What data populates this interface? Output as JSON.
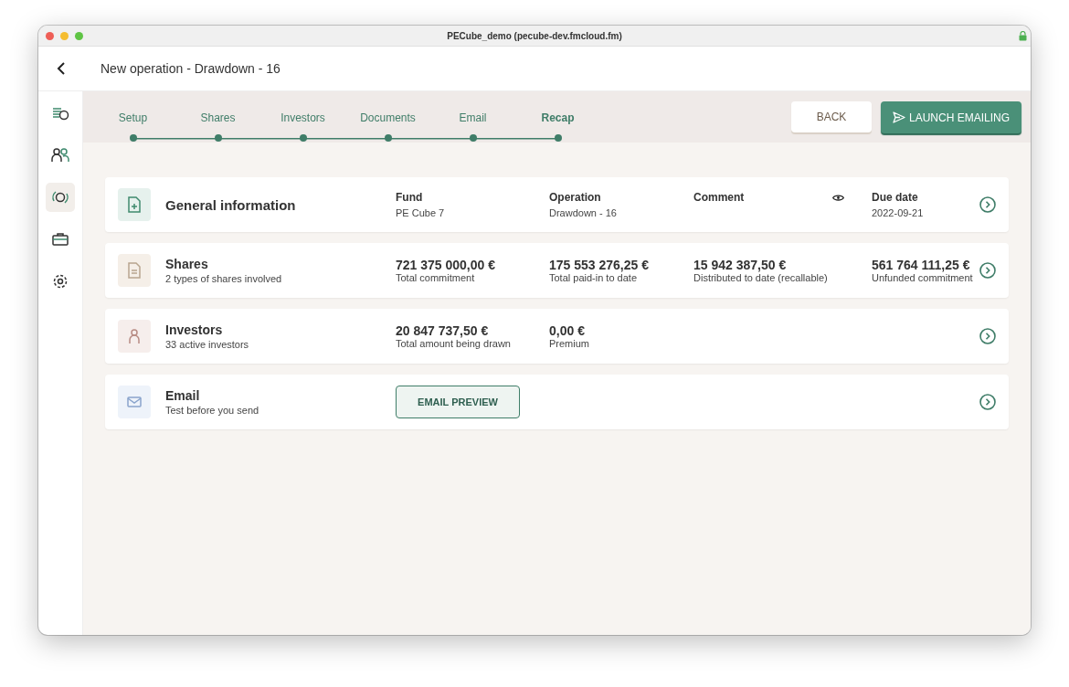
{
  "window": {
    "title": "PECube_demo (pecube-dev.fmcloud.fm)"
  },
  "header": {
    "title": "New operation - Drawdown - 16"
  },
  "sidebar": {
    "items": [
      {
        "kind": "funds",
        "selected": false
      },
      {
        "kind": "people",
        "selected": false
      },
      {
        "kind": "operations",
        "selected": true
      },
      {
        "kind": "portfolio",
        "selected": false
      },
      {
        "kind": "settings",
        "selected": false
      }
    ]
  },
  "steps": [
    {
      "label": "Setup",
      "selected": false
    },
    {
      "label": "Shares",
      "selected": false
    },
    {
      "label": "Investors",
      "selected": false
    },
    {
      "label": "Documents",
      "selected": false
    },
    {
      "label": "Email",
      "selected": false
    },
    {
      "label": "Recap",
      "selected": true
    }
  ],
  "actions": {
    "back": "BACK",
    "launch": "LAUNCH EMAILING"
  },
  "sections": [
    {
      "kind": "general",
      "color": "#e6f1ed",
      "title": "General information",
      "fields": [
        {
          "kind": "labelled",
          "label": "Fund",
          "value": "PE Cube 7"
        },
        {
          "kind": "labelled",
          "label": "Operation",
          "value": "Drawdown - 16"
        },
        {
          "kind": "preview",
          "label": "Comment"
        },
        {
          "kind": "labelled",
          "label": "Due date",
          "value": "2022-09-21"
        }
      ]
    },
    {
      "kind": "shares",
      "color": "#f5efe8",
      "title": "Shares",
      "subtitle": "2 types of shares involved",
      "fields": [
        {
          "kind": "figure",
          "value": "721 375 000,00 €",
          "label": "Total commitment"
        },
        {
          "kind": "figure",
          "value": "175 553 276,25 €",
          "label": "Total paid-in to date"
        },
        {
          "kind": "figure",
          "value": "15 942 387,50 €",
          "label": "Distributed to date (recallable)"
        },
        {
          "kind": "figure",
          "value": "561 764 111,25 €",
          "label": "Unfunded commitment"
        }
      ]
    },
    {
      "kind": "investors",
      "color": "#f6eeec",
      "title": "Investors",
      "subtitle": "33 active investors",
      "fields": [
        {
          "kind": "figure",
          "value": "20 847 737,50 €",
          "label": "Total amount being drawn"
        },
        {
          "kind": "figure",
          "value": "0,00 €",
          "label": "Premium"
        }
      ]
    },
    {
      "kind": "email",
      "color": "#eef3fa",
      "title": "Email",
      "subtitle": "Test before you send",
      "fields": [
        {
          "kind": "button",
          "label": "EMAIL PREVIEW"
        }
      ]
    }
  ]
}
